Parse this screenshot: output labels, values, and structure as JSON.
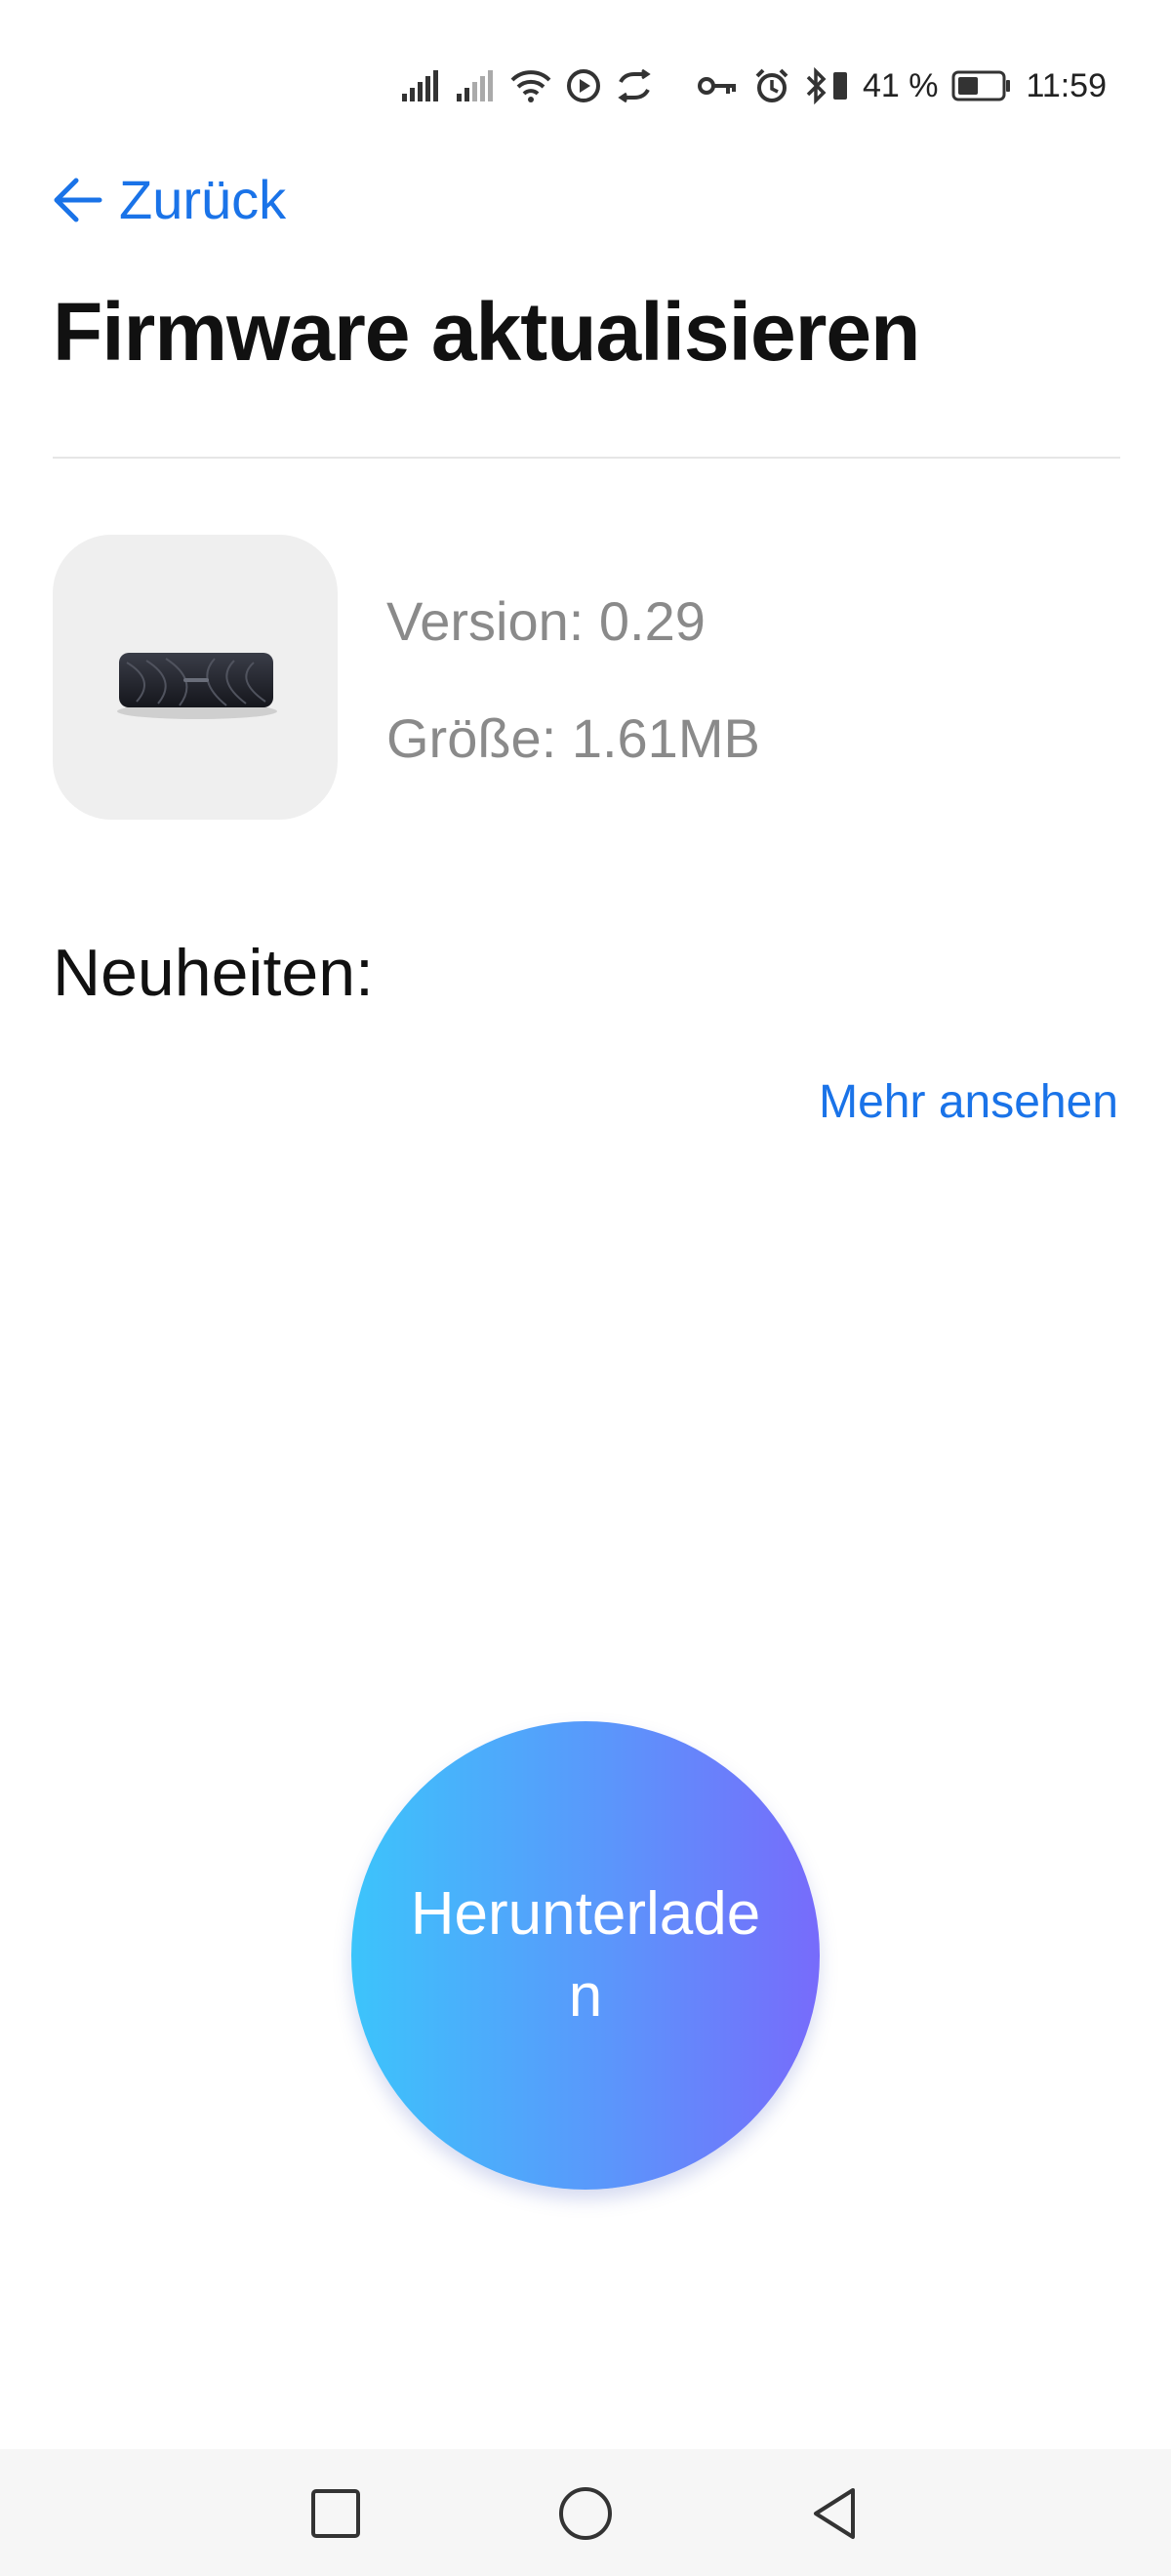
{
  "status_bar": {
    "icons": [
      "signal-icon",
      "signal-icon",
      "wifi-icon",
      "media-icon",
      "sync-icon",
      "key-icon",
      "alarm-icon",
      "bluetooth-icon",
      "battery-icon"
    ],
    "battery_percent": "41 %",
    "time": "11:59"
  },
  "header": {
    "back_label": "Zurück",
    "back_icon": "arrow-left-icon",
    "title": "Firmware aktualisieren"
  },
  "firmware": {
    "image": "speaker-image",
    "version": "Version: 0.29",
    "size": "Größe: 1.61MB"
  },
  "news": {
    "label": "Neuheiten:",
    "more_link": "Mehr ansehen"
  },
  "download": {
    "label": "Herunterladen",
    "gradient_start": "#3cc4fb",
    "gradient_end": "#776bfb"
  },
  "nav_bar": {
    "buttons": [
      "recent-apps-icon",
      "home-icon",
      "back-icon"
    ]
  },
  "colors": {
    "accent": "#1a73e8",
    "muted_text": "#8a8a8a"
  }
}
